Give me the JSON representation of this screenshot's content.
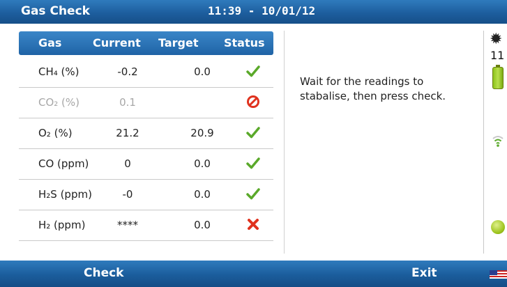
{
  "window": {
    "app_title": "Gas Check",
    "clock": "11:39 - 10/01/12"
  },
  "table": {
    "headers": [
      "Gas",
      "Current",
      "Target",
      "Status"
    ],
    "rows": [
      {
        "gas": "CH₄ (%)",
        "current": "-0.2",
        "target": "0.0",
        "status": "ok-check-icon",
        "dim": false
      },
      {
        "gas": "CO₂ (%)",
        "current": "0.1",
        "target": "",
        "status": "prohibited-icon",
        "dim": true
      },
      {
        "gas": "O₂  (%)",
        "current": "21.2",
        "target": "20.9",
        "status": "ok-check-icon",
        "dim": false
      },
      {
        "gas": "CO  (ppm)",
        "current": "0",
        "target": "0.0",
        "status": "ok-check-icon",
        "dim": false
      },
      {
        "gas": "H₂S (ppm)",
        "current": "-0",
        "target": "0.0",
        "status": "ok-check-icon",
        "dim": false
      },
      {
        "gas": "H₂  (ppm)",
        "current": "****",
        "target": "0.0",
        "status": "fail-cross-icon",
        "dim": false
      }
    ]
  },
  "message": "Wait for the readings to stabalise, then press check.",
  "sidebar": {
    "fan_speed": "11",
    "icons": [
      "fan-icon",
      "battery-icon",
      "wifi-signal-icon",
      "status-ok-icon"
    ]
  },
  "footer": {
    "check_label": "Check",
    "exit_label": "Exit",
    "flag_icon": "us-flag-icon"
  },
  "colors": {
    "accent": "#1f63a6",
    "ok": "#5aa92a",
    "fail": "#e0321e"
  }
}
